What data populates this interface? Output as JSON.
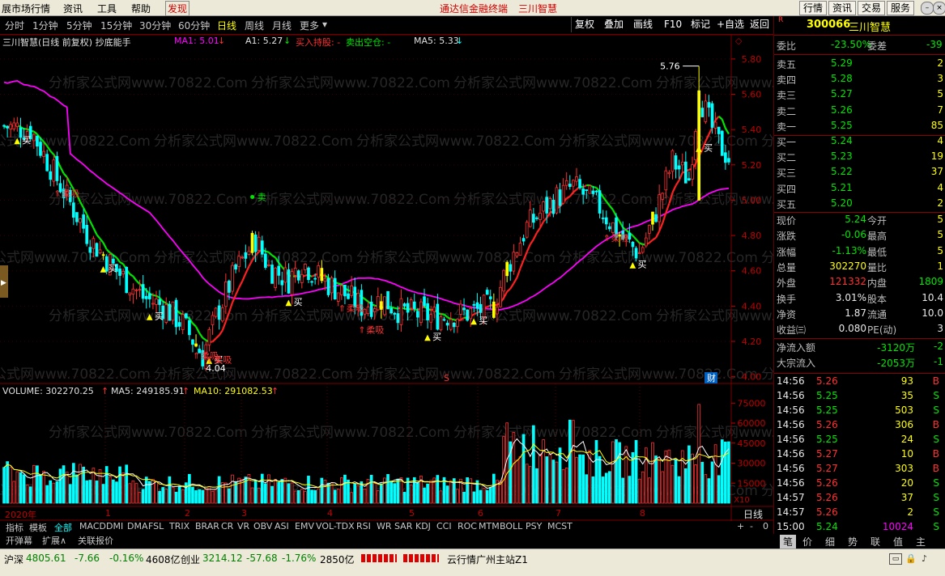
{
  "menubar": {
    "items": [
      "展市场行情",
      "资讯",
      "工具",
      "帮助",
      "发现"
    ],
    "promo": [
      "通达信金融终端",
      "三川智慧"
    ],
    "right_buttons": [
      "行情",
      "资讯",
      "交易",
      "服务"
    ]
  },
  "periodbar": {
    "periods": [
      "分时",
      "1分钟",
      "5分钟",
      "15分钟",
      "30分钟",
      "60分钟",
      "日线",
      "周线",
      "月线",
      "更多"
    ],
    "active": "日线",
    "tools": [
      "复权",
      "叠加",
      "画线",
      "F10",
      "标记",
      "+自选",
      "返回"
    ]
  },
  "chart_info": {
    "title": "三川智慧(日线 前复权) 抄底能手",
    "ma1": "MA1: 5.01",
    "a1": "A1: 5.27",
    "buy_hold": "买入持股: -",
    "sell_empty": "卖出空仓: -",
    "ma5": "MA5: 5.33"
  },
  "price_axis": [
    "5.80",
    "5.60",
    "5.40",
    "5.20",
    "5.00",
    "4.80",
    "4.60",
    "4.40",
    "4.20",
    "4.00"
  ],
  "annotations": {
    "high": "5.76",
    "low": "4.04",
    "buy_label": "买",
    "sell_label": "卖",
    "suction_label": "柔吸",
    "s_marker": "S",
    "cai_marker": "财"
  },
  "volume_info": {
    "volume": "VOLUME: 302270.25",
    "ma5": "MA5: 249185.91",
    "ma10": "MA10: 291082.53",
    "axis": [
      "75000",
      "60000",
      "45000",
      "30000",
      "15000"
    ],
    "unit": "X10"
  },
  "months": [
    "2020年",
    "1",
    "2",
    "3",
    "4",
    "5",
    "6",
    "7",
    "8"
  ],
  "indicator_tabs": [
    "指标",
    "模板",
    "全部",
    "MACD",
    "DMI",
    "DMA",
    "FSL",
    "TRIX",
    "BRAR",
    "CR",
    "VR",
    "OBV",
    "ASI",
    "EMV",
    "VOL-TDX",
    "RSI",
    "WR",
    "SAR",
    "KDJ",
    "CCI",
    "ROC",
    "MTM",
    "BOLL",
    "PSY",
    "MCST"
  ],
  "sub_tabs": [
    "开弹幕",
    "扩展∧",
    "关联报价"
  ],
  "chart_period_label": "日线",
  "stock": {
    "code": "300066",
    "name": "三川智慧",
    "committee_ratio_label": "委比",
    "committee_ratio": "-23.50%",
    "committee_diff_label": "委差",
    "committee_diff": "-39",
    "asks": [
      {
        "label": "卖五",
        "price": "5.29",
        "vol": "2"
      },
      {
        "label": "卖四",
        "price": "5.28",
        "vol": "3"
      },
      {
        "label": "卖三",
        "price": "5.27",
        "vol": "5"
      },
      {
        "label": "卖二",
        "price": "5.26",
        "vol": "7"
      },
      {
        "label": "卖一",
        "price": "5.25",
        "vol": "85"
      }
    ],
    "bids": [
      {
        "label": "买一",
        "price": "5.24",
        "vol": "4"
      },
      {
        "label": "买二",
        "price": "5.23",
        "vol": "19"
      },
      {
        "label": "买三",
        "price": "5.22",
        "vol": "37"
      },
      {
        "label": "买四",
        "price": "5.21",
        "vol": "4"
      },
      {
        "label": "买五",
        "price": "5.20",
        "vol": "2"
      }
    ],
    "stats": [
      {
        "l1": "现价",
        "v1": "5.24",
        "l2": "今开",
        "v2": "5"
      },
      {
        "l1": "涨跌",
        "v1": "-0.06",
        "l2": "最高",
        "v2": "5"
      },
      {
        "l1": "涨幅",
        "v1": "-1.13%",
        "l2": "最低",
        "v2": "5"
      },
      {
        "l1": "总量",
        "v1": "302270",
        "l2": "量比",
        "v2": "1"
      },
      {
        "l1": "外盘",
        "v1": "121332",
        "l2": "内盘",
        "v2": "1809"
      },
      {
        "l1": "换手",
        "v1": "3.01%",
        "l2": "股本",
        "v2": "10.4"
      },
      {
        "l1": "净资",
        "v1": "1.87",
        "l2": "流通",
        "v2": "10.0"
      },
      {
        "l1": "收益㈢",
        "v1": "0.080",
        "l2": "PE(动)",
        "v2": "3"
      }
    ],
    "flows": [
      {
        "label": "净流入额",
        "v1": "-3120万",
        "v2": "-2"
      },
      {
        "label": "大宗流入",
        "v1": "-2053万",
        "v2": "-1"
      }
    ],
    "ticks": [
      {
        "t": "14:56",
        "p": "5.26",
        "v": "93",
        "s": "B"
      },
      {
        "t": "14:56",
        "p": "5.25",
        "v": "35",
        "s": "S"
      },
      {
        "t": "14:56",
        "p": "5.25",
        "v": "503",
        "s": "S"
      },
      {
        "t": "14:56",
        "p": "5.26",
        "v": "306",
        "s": "B"
      },
      {
        "t": "14:56",
        "p": "5.25",
        "v": "24",
        "s": "S"
      },
      {
        "t": "14:56",
        "p": "5.27",
        "v": "10",
        "s": "B"
      },
      {
        "t": "14:56",
        "p": "5.27",
        "v": "303",
        "s": "B"
      },
      {
        "t": "14:56",
        "p": "5.26",
        "v": "20",
        "s": "S"
      },
      {
        "t": "14:57",
        "p": "5.26",
        "v": "37",
        "s": "S"
      },
      {
        "t": "14:57",
        "p": "5.26",
        "v": "2",
        "s": "S"
      },
      {
        "t": "15:00",
        "p": "5.24",
        "v": "10024",
        "s": "S"
      }
    ],
    "bottom_tabs": [
      "笔",
      "价",
      "细",
      "势",
      "联",
      "值",
      "主"
    ]
  },
  "statusbar": {
    "sh_label": "沪深",
    "sh_value": "4805.61",
    "sh_change": "-7.66",
    "sh_pct": "-0.16%",
    "sh_amount": "4608亿",
    "cy_label": "创业",
    "cy_value": "3214.12",
    "cy_change": "-57.68",
    "cy_pct": "-1.76%",
    "cy_amount": "2850亿",
    "server": "云行情广州主站Z1"
  },
  "watermark": "分析家公式网www.70822.Com",
  "colors": {
    "up": "#ff3030",
    "down": "#00ffff",
    "ma_pink": "#ff00ff",
    "ma_trend_red": "#ff2020",
    "ma_trend_green": "#00e600",
    "signal_yellow": "#ffff00"
  }
}
